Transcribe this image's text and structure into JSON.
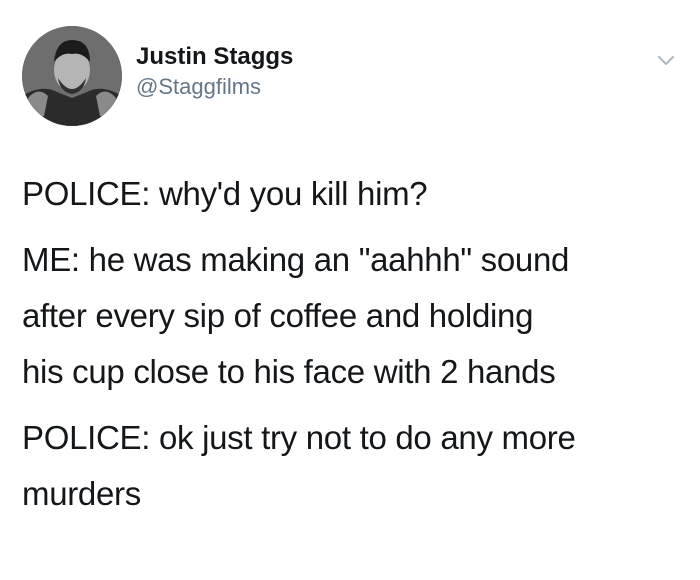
{
  "tweet": {
    "author": {
      "display_name": "Justin Staggs",
      "handle": "@Staggfilms",
      "avatar": "avatar-photo"
    },
    "menu_icon": "chevron-down-icon",
    "paragraphs": [
      "POLICE: why'd you kill him?",
      "ME: he was making an \"aahhh\" sound\nafter every sip of coffee and holding\nhis cup close to his face with 2 hands",
      "POLICE: ok just try not to do any more\nmurders"
    ]
  },
  "colors": {
    "text": "#14171a",
    "secondary": "#657786",
    "chevron": "#aab8c2",
    "background": "#ffffff"
  }
}
